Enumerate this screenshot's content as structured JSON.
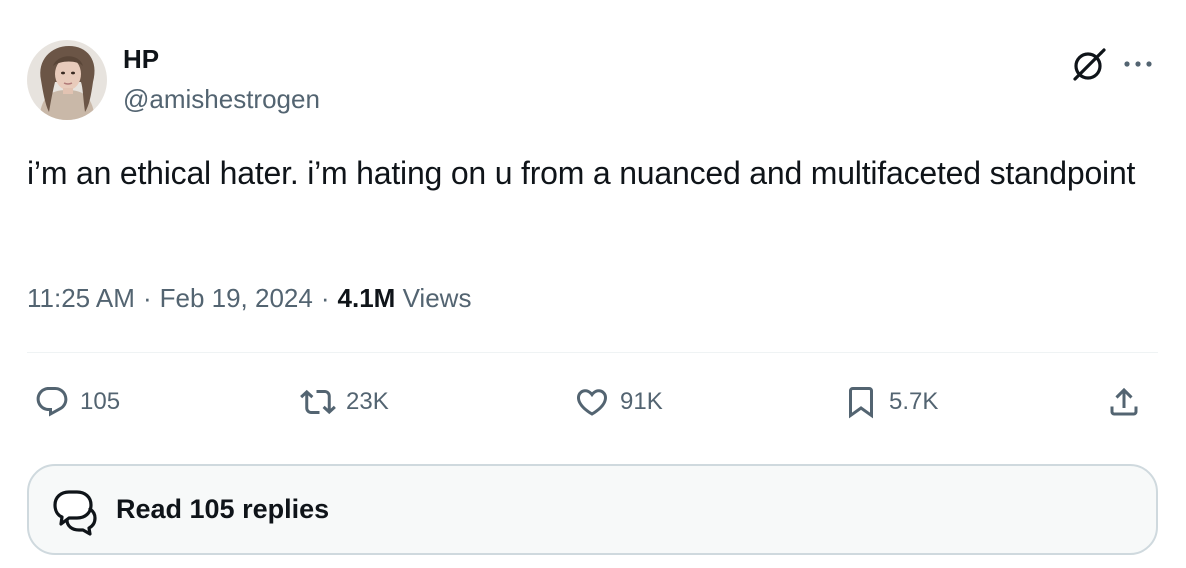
{
  "author": {
    "display_name": "HP",
    "handle": "@amishestrogen"
  },
  "tweet": {
    "text": "i’m an ethical hater. i’m hating on u from a nuanced and multifaceted standpoint"
  },
  "meta": {
    "time": "11:25 AM",
    "separator": "·",
    "date": "Feb 19, 2024",
    "views_count": "4.1M",
    "views_label": "Views"
  },
  "actions": {
    "replies": "105",
    "reposts": "23K",
    "likes": "91K",
    "bookmarks": "5.7K"
  },
  "read_replies": {
    "label": "Read 105 replies"
  },
  "icons": {
    "header": [
      "grok-icon",
      "more-icon"
    ],
    "actions": [
      "reply-icon",
      "repost-icon",
      "like-icon",
      "bookmark-icon",
      "share-icon"
    ],
    "read_replies": "replies-bubble-icon"
  },
  "colors": {
    "text_primary": "#0f1419",
    "text_secondary": "#536471",
    "divider": "#eff3f4",
    "button_border": "#cfd9de",
    "button_bg": "#f7f9f9"
  }
}
